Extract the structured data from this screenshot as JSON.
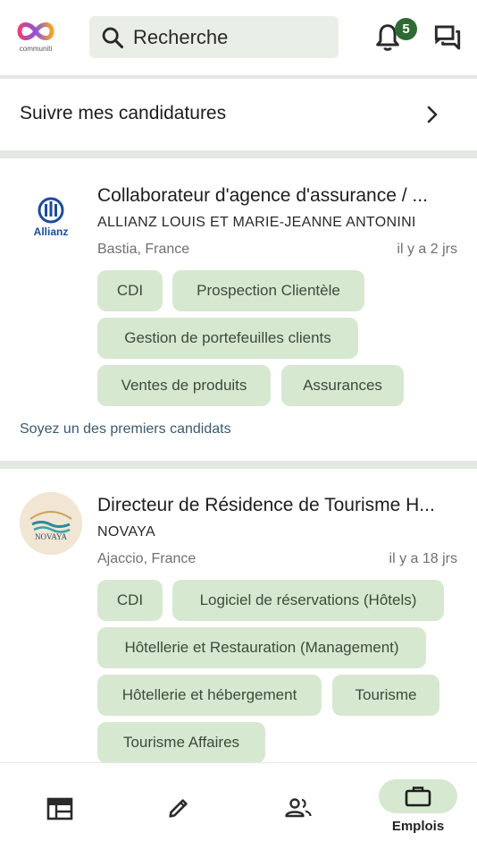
{
  "header": {
    "logo_text": "communiti",
    "search_placeholder": "Recherche",
    "notification_count": "5"
  },
  "follow": {
    "label": "Suivre mes candidatures"
  },
  "jobs": [
    {
      "logo_text": "Allianz",
      "title": "Collaborateur d'agence d'assurance / ...",
      "company": "ALLIANZ LOUIS ET MARIE-JEANNE ANTONINI",
      "location": "Bastia, France",
      "date": "il y a 2 jrs",
      "tags": [
        "CDI",
        "Prospection Clientèle",
        "Gestion de portefeuilles clients",
        "Ventes de produits",
        "Assurances"
      ],
      "note": "Soyez un des premiers candidats"
    },
    {
      "logo_text": "NOVAYA",
      "title": "Directeur de Résidence de Tourisme H...",
      "company": "NOVAYA",
      "location": "Ajaccio, France",
      "date": "il y a 18 jrs",
      "tags": [
        "CDI",
        "Logiciel de réservations (Hôtels)",
        "Hôtellerie et Restauration (Management)",
        "Hôtellerie et hébergement",
        "Tourisme",
        "Tourisme Affaires"
      ]
    }
  ],
  "bottom_nav": {
    "active_label": "Emplois",
    "items": [
      "news-feed-icon",
      "edit-icon",
      "people-icon",
      "briefcase-icon"
    ]
  },
  "colors": {
    "accent": "#2e6b34",
    "chip_bg": "#d7e8d1",
    "search_bg": "#e9efe6",
    "divider": "#e4e8e2",
    "note": "#3b5a6e"
  }
}
